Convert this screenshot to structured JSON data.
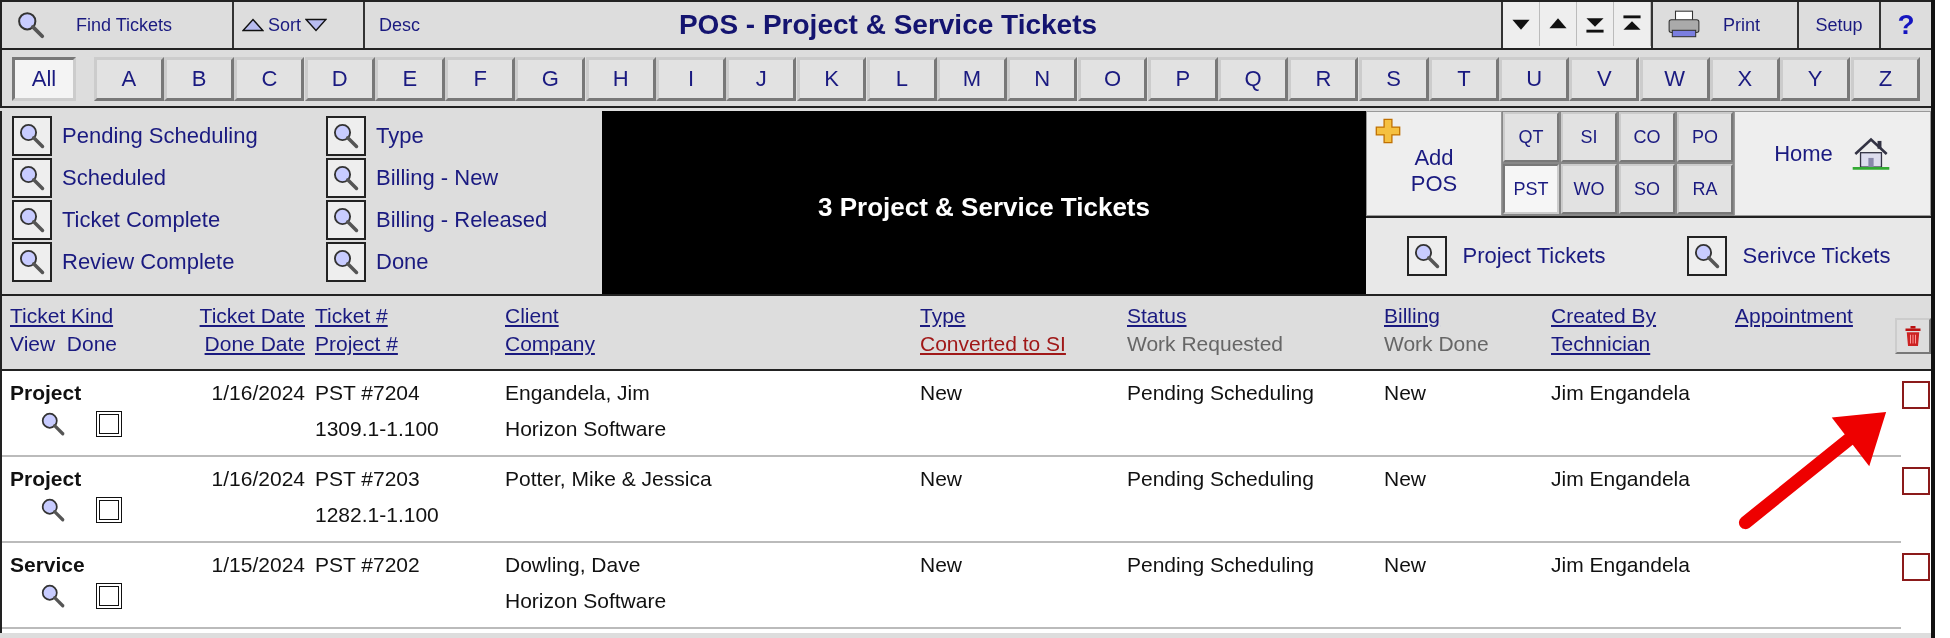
{
  "toolbar": {
    "find": "Find Tickets",
    "sort": "Sort",
    "order": "Desc",
    "title": "POS - Project & Service Tickets",
    "print": "Print",
    "setup": "Setup",
    "help": "?"
  },
  "letters": [
    {
      "label": "All",
      "selected": true
    },
    {
      "label": "A",
      "selected": false
    },
    {
      "label": "B",
      "selected": false
    },
    {
      "label": "C",
      "selected": false
    },
    {
      "label": "D",
      "selected": false
    },
    {
      "label": "E",
      "selected": false
    },
    {
      "label": "F",
      "selected": false
    },
    {
      "label": "G",
      "selected": false
    },
    {
      "label": "H",
      "selected": false
    },
    {
      "label": "I",
      "selected": false
    },
    {
      "label": "J",
      "selected": false
    },
    {
      "label": "K",
      "selected": false
    },
    {
      "label": "L",
      "selected": false
    },
    {
      "label": "M",
      "selected": false
    },
    {
      "label": "N",
      "selected": false
    },
    {
      "label": "O",
      "selected": false
    },
    {
      "label": "P",
      "selected": false
    },
    {
      "label": "Q",
      "selected": false
    },
    {
      "label": "R",
      "selected": false
    },
    {
      "label": "S",
      "selected": false
    },
    {
      "label": "T",
      "selected": false
    },
    {
      "label": "U",
      "selected": false
    },
    {
      "label": "V",
      "selected": false
    },
    {
      "label": "W",
      "selected": false
    },
    {
      "label": "X",
      "selected": false
    },
    {
      "label": "Y",
      "selected": false
    },
    {
      "label": "Z",
      "selected": false
    }
  ],
  "filters": [
    [
      "Pending Scheduling",
      "Scheduled",
      "Ticket Complete",
      "Review Complete"
    ],
    [
      "Type",
      "Billing - New",
      "Billing - Released",
      "Done"
    ]
  ],
  "summary": "3 Project & Service Tickets",
  "add": {
    "line1": "Add",
    "line2": "POS"
  },
  "doc_types": [
    {
      "label": "QT",
      "selected": false
    },
    {
      "label": "SI",
      "selected": false
    },
    {
      "label": "CO",
      "selected": false
    },
    {
      "label": "PO",
      "selected": false
    },
    {
      "label": "PST",
      "selected": true
    },
    {
      "label": "WO",
      "selected": false
    },
    {
      "label": "SO",
      "selected": false
    },
    {
      "label": "RA",
      "selected": false
    }
  ],
  "home": "Home",
  "quick_finds": [
    "Project Tickets",
    "Serivce Tickets"
  ],
  "columns": [
    {
      "line1": {
        "text": "Ticket Kind",
        "kind": "link"
      },
      "line2": {
        "text": "View  Done",
        "kind": "plain"
      }
    },
    {
      "line1": {
        "text": "Ticket Date",
        "kind": "link"
      },
      "line2": {
        "text": "Done Date",
        "kind": "link"
      }
    },
    {
      "line1": {
        "text": "Ticket #",
        "kind": "link"
      },
      "line2": {
        "text": "Project #",
        "kind": "link"
      }
    },
    {
      "line1": {
        "text": "Client",
        "kind": "link"
      },
      "line2": {
        "text": "Company",
        "kind": "link"
      }
    },
    {
      "line1": {
        "text": "Type",
        "kind": "link"
      },
      "line2": {
        "text": "Converted to SI",
        "kind": "alert"
      }
    },
    {
      "line1": {
        "text": "Status",
        "kind": "link"
      },
      "line2": {
        "text": "Work Requested",
        "kind": "muted"
      }
    },
    {
      "line1": {
        "text": "Billing",
        "kind": "link"
      },
      "line2": {
        "text": "Work Done",
        "kind": "muted"
      }
    },
    {
      "line1": {
        "text": "Created By",
        "kind": "link"
      },
      "line2": {
        "text": "Technician",
        "kind": "link"
      }
    },
    {
      "line1": {
        "text": "Appointment",
        "kind": "link"
      }
    }
  ],
  "rows": [
    {
      "kind": "Project",
      "done": false,
      "date": "1/16/2024",
      "ticket": "PST #7204",
      "project": "1309.1-1.100",
      "client": "Engandela, Jim",
      "company": "Horizon Software",
      "type": "New",
      "status": "Pending Scheduling",
      "billing": "New",
      "created_by": "Jim Engandela",
      "marked": false
    },
    {
      "kind": "Project",
      "done": false,
      "date": "1/16/2024",
      "ticket": "PST #7203",
      "project": "1282.1-1.100",
      "client": "Potter, Mike & Jessica",
      "type": "New",
      "status": "Pending Scheduling",
      "billing": "New",
      "created_by": "Jim Engandela",
      "marked": false
    },
    {
      "kind": "Service",
      "done": false,
      "date": "1/15/2024",
      "ticket": "PST #7202",
      "client": "Dowling, Dave",
      "company": "Horizon Software",
      "type": "New",
      "status": "Pending Scheduling",
      "billing": "New",
      "created_by": "Jim Engandela",
      "marked": false
    }
  ]
}
